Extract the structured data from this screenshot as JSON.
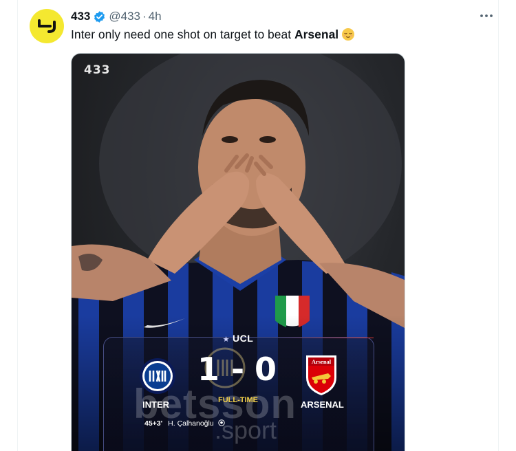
{
  "tweet": {
    "display_name": "433",
    "handle": "@433",
    "separator": "·",
    "time": "4h",
    "text_before": "Inter only need one shot on target to beat ",
    "text_bold": "Arsenal",
    "emoji": "relieved-face-emoji"
  },
  "media": {
    "brand": "433",
    "competition": "UCL",
    "home_team": "INTER",
    "away_team": "ARSENAL",
    "home_score": "1",
    "score_separator": "-",
    "away_score": "0",
    "status": "FULL-TIME",
    "goal_minute": "45+3'",
    "scorer": "H. Çalhanoğlu",
    "sponsor_watermark": "betsson",
    "sponsor_watermark_sub": ".sport",
    "crest_away_text": "Arsenal"
  },
  "colors": {
    "accent_yellow": "#f4e830",
    "verified_blue": "#1d9bf0",
    "muted_text": "#536471",
    "full_time_yellow": "#f2d04a",
    "arsenal_red": "#db0007",
    "inter_blue": "#0a3d91"
  },
  "icons": {
    "avatar": "433-logo",
    "verified": "verified-badge-icon",
    "more": "more-options-icon",
    "goal": "football-icon"
  }
}
